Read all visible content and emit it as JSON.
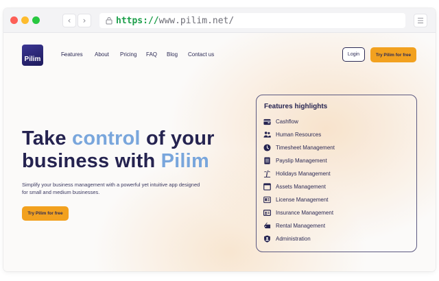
{
  "browser": {
    "url_protocol": "https://",
    "url_rest": "www.pilim.net/",
    "back_icon": "‹",
    "forward_icon": "›",
    "menu_icon": "☰"
  },
  "site": {
    "logo_text": "Pilim",
    "nav": [
      {
        "label": "Features",
        "has_dropdown": true
      },
      {
        "label": "About"
      },
      {
        "label": "Pricing"
      },
      {
        "label": "FAQ"
      },
      {
        "label": "Blog"
      },
      {
        "label": "Contact us"
      }
    ],
    "login_label": "Login",
    "try_label": "Try Pilim for free"
  },
  "hero": {
    "line1_a": "Take ",
    "line1_accent": "control",
    "line1_b": " of your",
    "line2_a": "business with ",
    "line2_accent": "Pilim",
    "subtitle": "Simplify your business management with a powerful yet intuitive app designed for small and medium businesses.",
    "cta_label": "Try Pilim for free"
  },
  "features": {
    "title": "Features highlights",
    "items": [
      {
        "label": "Cashflow",
        "icon": "wallet-icon"
      },
      {
        "label": "Human Resources",
        "icon": "users-icon"
      },
      {
        "label": "Timesheet Management",
        "icon": "clock-icon"
      },
      {
        "label": "Payslip Management",
        "icon": "document-icon"
      },
      {
        "label": "Holidays Management",
        "icon": "palm-tree-icon"
      },
      {
        "label": "Assets Management",
        "icon": "window-icon"
      },
      {
        "label": "License Management",
        "icon": "license-icon"
      },
      {
        "label": "Insurance Management",
        "icon": "id-card-icon"
      },
      {
        "label": "Rental Management",
        "icon": "tag-icon"
      },
      {
        "label": "Administration",
        "icon": "shield-user-icon"
      }
    ]
  },
  "colors": {
    "brand_navy": "#252350",
    "accent_blue": "#79a6dc",
    "cta_orange": "#f2a11f"
  }
}
